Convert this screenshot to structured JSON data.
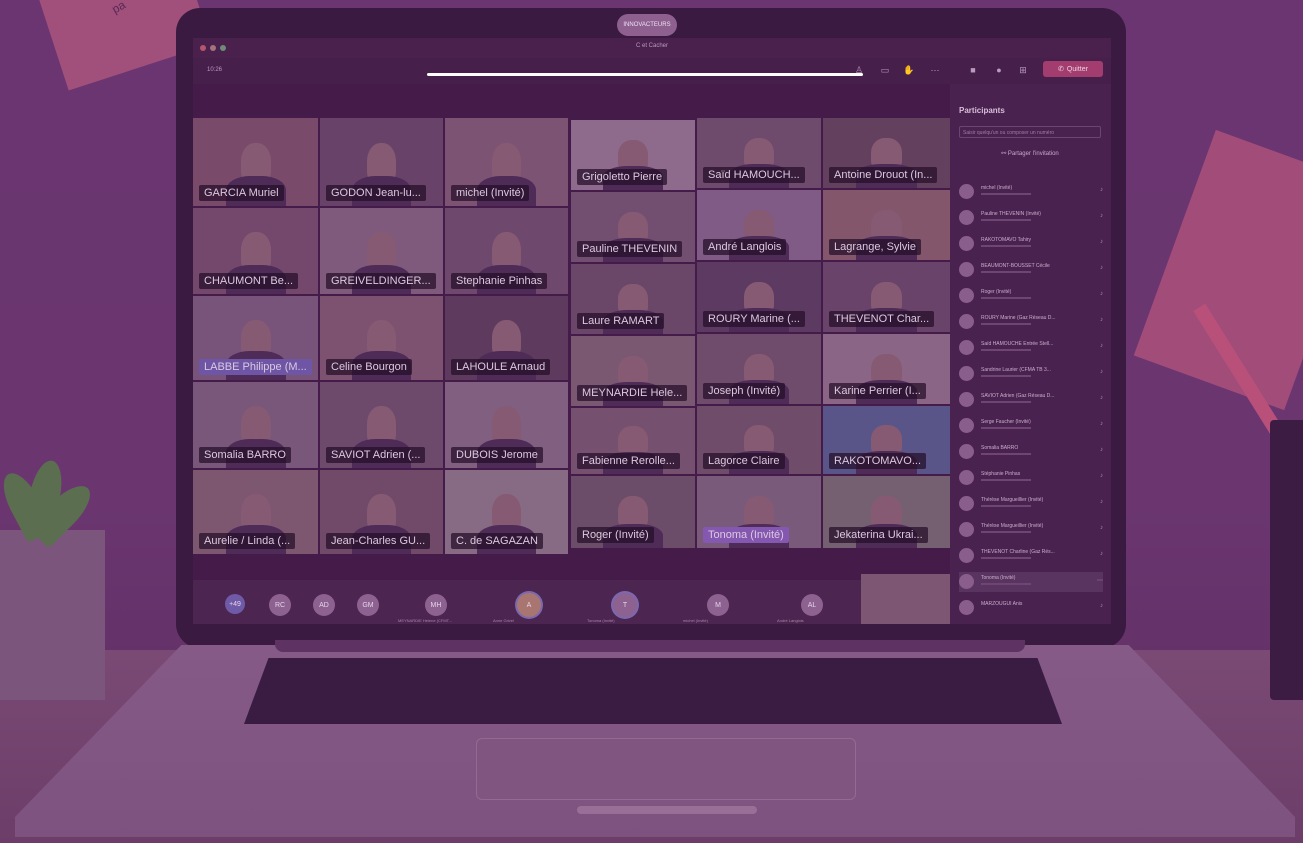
{
  "window": {
    "title": "C et Cacher",
    "time": "10:26",
    "leave_label": "Quitter"
  },
  "laptop_logo": "INNOVACTEURS",
  "sticky_note": "pa",
  "panel": {
    "title": "Participants",
    "search_placeholder": "Saisir quelqu'un ou composer un numéro",
    "share_label": "Partager l'invitation",
    "participants": [
      {
        "name": "michel (Invité)"
      },
      {
        "name": "Pauline THEVENIN (Invité)"
      },
      {
        "name": "RAKOTOMAVO Tahiry"
      },
      {
        "name": "BEAUMONT-BOUSSET Cécile"
      },
      {
        "name": "Roger (Invité)"
      },
      {
        "name": "ROURY Marine (Gaz Réseau D..."
      },
      {
        "name": "Saïd HAMOUCHE Entrée Stell..."
      },
      {
        "name": "Sandrine Laurier (CFMA TB 3..."
      },
      {
        "name": "SAVIOT Adrien (Gaz Réseau D..."
      },
      {
        "name": "Serge Faucher (Invité)"
      },
      {
        "name": "Somalia BARRO"
      },
      {
        "name": "Stéphanie Pinhas"
      },
      {
        "name": "Thérèse Margueillier (Invité)"
      },
      {
        "name": "Thérèse Margueillier (Invité)"
      },
      {
        "name": "THEVENOT Charline (Gaz Rés..."
      },
      {
        "name": "Tonoma (Invité)"
      },
      {
        "name": "MARZOUGUI Anis"
      }
    ]
  },
  "video_tiles": [
    {
      "name": "GARCIA Muriel"
    },
    {
      "name": "GODON Jean-lu..."
    },
    {
      "name": "michel (Invité)"
    },
    {
      "name": "Grigoletto Pierre"
    },
    {
      "name": "Saïd HAMOUCH..."
    },
    {
      "name": "Antoine Drouot (In..."
    },
    {
      "name": "CHAUMONT Be..."
    },
    {
      "name": "GREIVELDINGER..."
    },
    {
      "name": "Stephanie Pinhas"
    },
    {
      "name": "Pauline THEVENIN"
    },
    {
      "name": "André Langlois"
    },
    {
      "name": "Lagrange, Sylvie"
    },
    {
      "name": "LABBE Philippe (M..."
    },
    {
      "name": "Celine Bourgon"
    },
    {
      "name": "LAHOULE Arnaud"
    },
    {
      "name": "Laure RAMART"
    },
    {
      "name": "ROURY Marine (..."
    },
    {
      "name": "THEVENOT Char..."
    },
    {
      "name": "MEYNARDIE Hele..."
    },
    {
      "name": "Joseph (Invité)"
    },
    {
      "name": "Karine Perrier (I..."
    },
    {
      "name": "Somalia BARRO"
    },
    {
      "name": "SAVIOT Adrien (..."
    },
    {
      "name": "DUBOIS Jerome"
    },
    {
      "name": "Fabienne Rerolle..."
    },
    {
      "name": "Lagorce Claire"
    },
    {
      "name": "RAKOTOMAVO..."
    },
    {
      "name": "Aurelie / Linda (..."
    },
    {
      "name": "Jean-Charles GU..."
    },
    {
      "name": "C. de SAGAZAN"
    },
    {
      "name": "Roger (Invité)"
    },
    {
      "name": "Tonoma (Invité)"
    },
    {
      "name": "Jekaterina Ukrai..."
    }
  ],
  "bottom_strip": [
    {
      "initials": "+49"
    },
    {
      "initials": "RC"
    },
    {
      "initials": "AD"
    },
    {
      "initials": "GM"
    },
    {
      "initials": "MH",
      "label": "MEYNARDIE Helene (CFMT..."
    },
    {
      "initials": "A",
      "label": "Anne Grivel"
    },
    {
      "initials": "T",
      "label": "Tonoma (Invité)"
    },
    {
      "initials": "M",
      "label": "michel (Invité)"
    },
    {
      "initials": "AL",
      "label": "André Langlois"
    }
  ],
  "colors": {
    "overlay_purple": "#5e2d63",
    "progress_bar": "#ffffff",
    "leave_button": "#a43d6f",
    "name_label_bg": "#240e28"
  }
}
